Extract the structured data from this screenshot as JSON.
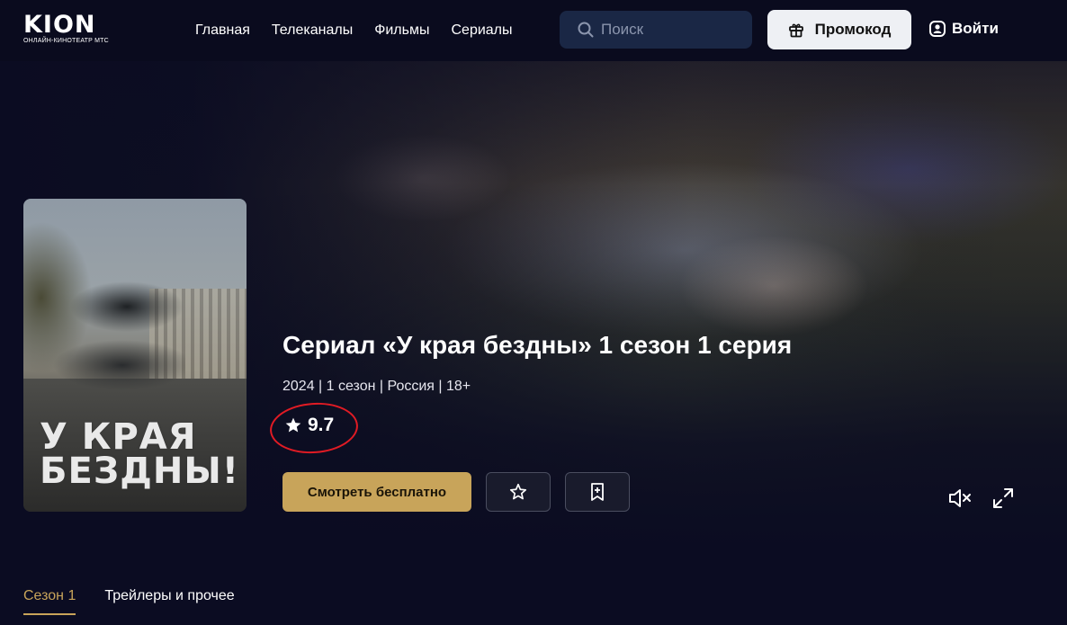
{
  "header": {
    "logo_text": "KION",
    "logo_subtitle": "ОНЛАЙН-КИНОТЕАТР МТС",
    "nav": [
      {
        "label": "Главная"
      },
      {
        "label": "Телеканалы"
      },
      {
        "label": "Фильмы"
      },
      {
        "label": "Сериалы"
      }
    ],
    "search_placeholder": "Поиск",
    "promo_label": "Промокод",
    "login_label": "Войти"
  },
  "poster": {
    "title_line1": "У КРАЯ",
    "title_line2": "БЕЗДНЫ!"
  },
  "content": {
    "title": "Сериал «У края бездны» 1 сезон 1 серия",
    "meta": "2024 | 1 сезон | Россия | 18+",
    "rating": "9.7",
    "watch_label": "Смотреть бесплатно"
  },
  "icons": {
    "search": "search-icon",
    "promo": "gift-icon",
    "login": "user-icon",
    "favorite": "star-icon",
    "bookmark": "bookmark-plus-icon",
    "mute": "mute-icon",
    "fullscreen": "fullscreen-icon"
  },
  "colors": {
    "accent": "#c8a45a",
    "background": "#0b0c22",
    "annotation": "#e11b24"
  },
  "tabs": [
    {
      "label": "Сезон 1",
      "active": true
    },
    {
      "label": "Трейлеры и прочее",
      "active": false
    }
  ]
}
